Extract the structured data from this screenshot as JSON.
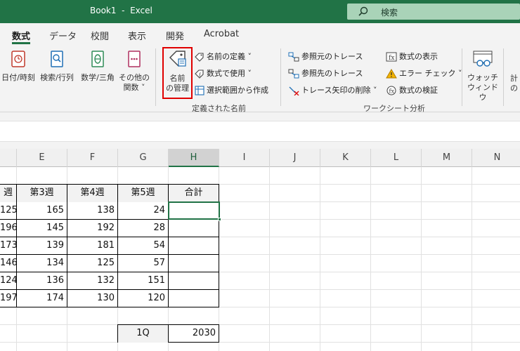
{
  "titlebar": {
    "title": "Book1  -  Excel",
    "search_label": "検索"
  },
  "tabs": [
    "数式",
    "データ",
    "校閲",
    "表示",
    "開発",
    "Acrobat"
  ],
  "ribbon": {
    "datetime": "日付/時刻",
    "lookup": "検索/行列",
    "math": "数学/三角",
    "more_line1": "その他の",
    "more_line2": "関数",
    "name_manager_line1": "名前",
    "name_manager_line2": "の管理",
    "define_name": "名前の定義",
    "use_in_formula": "数式で使用",
    "create_from_selection": "選択範囲から作成",
    "defined_names_group": "定義された名前",
    "trace_precedents": "参照元のトレース",
    "trace_dependents": "参照先のトレース",
    "remove_arrows": "トレース矢印の削除",
    "show_formulas": "数式の表示",
    "error_checking": "エラー チェック",
    "evaluate_formula": "数式の検証",
    "watch_line1": "ウォッチ",
    "watch_line2": "ウィンドウ",
    "audit_group": "ワークシート分析",
    "calc_cut_line1": "計",
    "calc_cut_line2": "の"
  },
  "columns": [
    "E",
    "F",
    "G",
    "H",
    "I",
    "J",
    "K",
    "L",
    "M",
    "N"
  ],
  "headers": [
    "週",
    "第3週",
    "第4週",
    "第5週",
    "合計"
  ],
  "rows": [
    [
      "125",
      "165",
      "138",
      "24",
      ""
    ],
    [
      "196",
      "145",
      "192",
      "28",
      ""
    ],
    [
      "173",
      "139",
      "181",
      "54",
      ""
    ],
    [
      "146",
      "134",
      "125",
      "57",
      ""
    ],
    [
      "124",
      "136",
      "132",
      "151",
      ""
    ],
    [
      "197",
      "174",
      "130",
      "120",
      ""
    ]
  ],
  "summary": {
    "label": "1Q",
    "value": "2030"
  }
}
